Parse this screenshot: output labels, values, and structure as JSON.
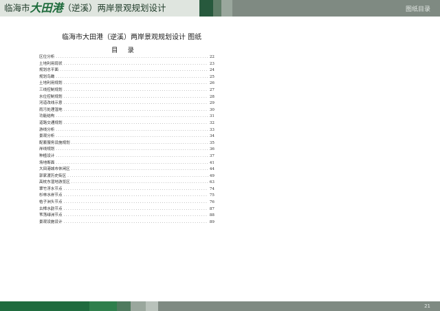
{
  "header": {
    "title_prefix": "临海市",
    "title_accent": "大田港",
    "title_suffix": "（逆溪）两岸景观规划设计",
    "section_label": "图纸目录"
  },
  "document": {
    "title": "临海市大田港（逆溪）两岸景观规划设计    图纸",
    "toc_heading": "目录"
  },
  "toc": [
    {
      "label": "区位分析",
      "page": "22"
    },
    {
      "label": "土地利用现状",
      "page": "23"
    },
    {
      "label": "规划总平面",
      "page": "24"
    },
    {
      "label": "规划鸟瞰",
      "page": "25"
    },
    {
      "label": "土地利用规划",
      "page": "26"
    },
    {
      "label": "三线控制规划",
      "page": "27"
    },
    {
      "label": "水位控制规划",
      "page": "28"
    },
    {
      "label": "河道改线示意",
      "page": "29"
    },
    {
      "label": "雨污处理湿地",
      "page": "30"
    },
    {
      "label": "功能结构",
      "page": "31"
    },
    {
      "label": "道路交通规划",
      "page": "32"
    },
    {
      "label": "游线分析",
      "page": "33"
    },
    {
      "label": "景观分析",
      "page": "34"
    },
    {
      "label": "配套服务设施规划",
      "page": "35"
    },
    {
      "label": "岸线规划",
      "page": "36"
    },
    {
      "label": "种植设计",
      "page": "37"
    },
    {
      "label": "场地断面",
      "page": "41"
    },
    {
      "label": "大田港城市休闲区",
      "page": "44"
    },
    {
      "label": "郭家渡历史街区",
      "page": "49"
    },
    {
      "label": "高枕东湿地游览区",
      "page": "63"
    },
    {
      "label": "翠竹浮水节点",
      "page": "74"
    },
    {
      "label": "杉林水岸节点",
      "page": "75"
    },
    {
      "label": "桔子洲头节点",
      "page": "76"
    },
    {
      "label": "古樟水韵节点",
      "page": "87"
    },
    {
      "label": "苇荡绿洲节点",
      "page": "88"
    },
    {
      "label": "景观设施设计",
      "page": "89"
    }
  ],
  "footer": {
    "page_number": "21"
  }
}
